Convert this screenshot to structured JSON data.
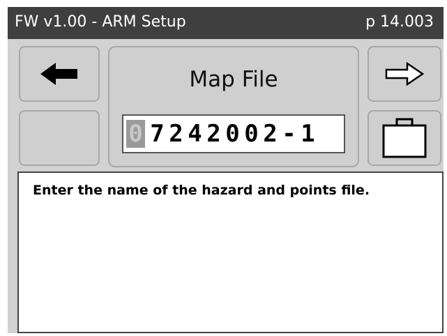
{
  "header": {
    "title": "FW v1.00 - ARM Setup",
    "page": "p 14.003"
  },
  "icons": {
    "back": "arrow-left-icon",
    "next": "arrow-right-icon",
    "case": "briefcase-icon"
  },
  "main": {
    "heading": "Map File",
    "entry_digits": [
      "0",
      "7",
      "2",
      "4",
      "2",
      "0",
      "0",
      "2",
      "-",
      "1"
    ]
  },
  "help": {
    "text": "Enter the name of the hazard and points file."
  },
  "colors": {
    "titlebar": "#3f3f3f",
    "screen_bg": "#d2d2d2",
    "cursor": "#9a9a9a"
  }
}
